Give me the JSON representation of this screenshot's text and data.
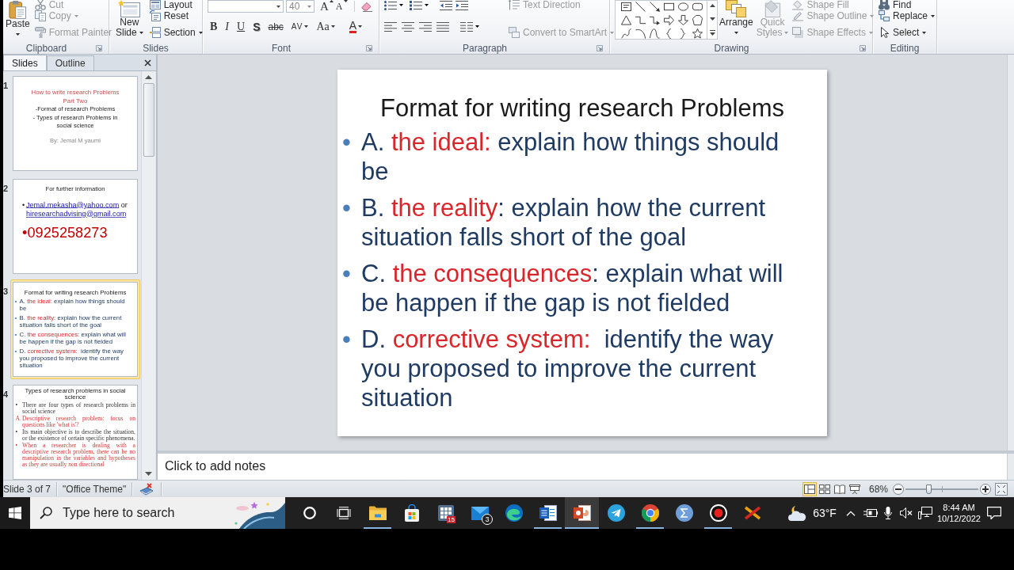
{
  "ribbon": {
    "clipboard": {
      "label": "Clipboard",
      "launcher": true,
      "paste": {
        "lines": [
          "Paste"
        ],
        "dropdown": true
      },
      "commands": [
        {
          "label": "Cut",
          "disabled": true,
          "dropdown": false
        },
        {
          "label": "Copy",
          "disabled": true,
          "dropdown": true
        },
        {
          "label": "Format Painter",
          "disabled": true,
          "dropdown": false
        }
      ]
    },
    "slides": {
      "label": "Slides",
      "new_slide": {
        "lines": [
          "New",
          "Slide"
        ],
        "dropdown": true
      },
      "commands": [
        {
          "label": "Layout",
          "disabled": false,
          "dropdown": false
        },
        {
          "label": "Reset",
          "disabled": false,
          "dropdown": false
        },
        {
          "label": "Section",
          "disabled": false,
          "dropdown": true
        }
      ]
    },
    "font": {
      "label": "Font",
      "launcher": true,
      "font_size": "40",
      "size_buttons": [
        {
          "kind": "grow",
          "glyph": "A"
        },
        {
          "kind": "shrink",
          "glyph": "A"
        }
      ],
      "format_buttons": [
        {
          "kind": "bold",
          "glyph": "B",
          "dropdown": false
        },
        {
          "kind": "italic",
          "glyph": "I",
          "dropdown": false
        },
        {
          "kind": "underline",
          "glyph": "U",
          "dropdown": false
        },
        {
          "kind": "shadow",
          "glyph": "S",
          "dropdown": false
        },
        {
          "kind": "strikethrough",
          "glyph": "abc",
          "dropdown": false
        },
        {
          "kind": "spacing",
          "glyph": "AV",
          "dropdown": true
        },
        {
          "kind": "case",
          "glyph": "Aa",
          "dropdown": true
        },
        {
          "kind": "color",
          "glyph": "A",
          "dropdown": true
        }
      ]
    },
    "paragraph": {
      "label": "Paragraph",
      "launcher": true,
      "commands": [
        {
          "label": "Text Direction",
          "disabled": true,
          "dropdown": false
        },
        {
          "label": "Convert to SmartArt",
          "disabled": true,
          "dropdown": true
        }
      ]
    },
    "drawing": {
      "label": "Drawing",
      "launcher": true,
      "arrange": {
        "lines": [
          "Arrange"
        ],
        "dropdown": true,
        "disabled": false
      },
      "quick_styles": {
        "lines": [
          "Quick",
          "Styles"
        ],
        "dropdown": true,
        "disabled": true
      },
      "commands": [
        {
          "label": "Shape Fill",
          "disabled": true,
          "dropdown": false
        },
        {
          "label": "Shape Outline",
          "disabled": true,
          "dropdown": true
        },
        {
          "label": "Shape Effects",
          "disabled": true,
          "dropdown": true
        }
      ]
    },
    "editing": {
      "label": "Editing",
      "commands": [
        {
          "label": "Find",
          "disabled": false,
          "dropdown": false
        },
        {
          "label": "Replace",
          "disabled": false,
          "dropdown": true
        },
        {
          "label": "Select",
          "disabled": false,
          "dropdown": true
        }
      ]
    }
  },
  "slides_pane": {
    "tabs": [
      {
        "label": "Slides",
        "selected": true
      },
      {
        "label": "Outline",
        "selected": false
      }
    ],
    "thumbnails": [
      {
        "number": "1",
        "selected": false,
        "kind": "title",
        "title_lines": [
          "How to write research Problems",
          "Part Two"
        ],
        "subtitle_lines": [
          "-Format of research Problems",
          "- Types of research Problems in social science"
        ],
        "byline": "By: Jemal M yaumi"
      },
      {
        "number": "2",
        "selected": false,
        "kind": "contact",
        "heading": "For further information",
        "contact": {
          "marker": "•",
          "links": [
            "Jemal.mekasha@yahoo.com",
            "hiresearchadvising@gmail.com"
          ],
          "joiner": "or"
        },
        "phone": {
          "marker": "•",
          "text": "0925258273"
        }
      },
      {
        "number": "3",
        "selected": true,
        "kind": "bullets",
        "title": "Format for writing research Problems",
        "bullets": [
          {
            "marker": "•",
            "letter": "A.",
            "term": "the ideal:",
            "rest": " explain how things should be"
          },
          {
            "marker": "•",
            "letter": "B.",
            "term": "the reality",
            "rest": ": explain how the current situation falls short of the goal"
          },
          {
            "marker": "•",
            "letter": "C.",
            "term": "the consequences",
            "rest": ": explain what will be happen if the gap is not fielded"
          },
          {
            "marker": "•",
            "letter": "D.",
            "term": "corrective system:",
            "rest": "  identify the way you proposed to improve the current situation"
          }
        ]
      },
      {
        "number": "4",
        "selected": false,
        "kind": "text",
        "title": "Types of research problems in social science",
        "paragraphs": [
          {
            "marker": "•",
            "text": "There are four types of research problems in social science",
            "emphasis": false
          },
          {
            "marker": "A.",
            "text": "Descriptive research problem: focus on questions like 'what is'?",
            "emphasis": true
          },
          {
            "marker": "•",
            "text": "Its main objective is to describe the situation, or the existence of certain specific phenomena.",
            "emphasis": false
          },
          {
            "marker": "•",
            "text": "When a researcher is dealing with a descriptive research problem, there can be no manipulation in the variables and hypotheses as they are usually non directional",
            "emphasis": true
          }
        ]
      }
    ]
  },
  "slide": {
    "title": "Format for writing research Problems",
    "bullets": [
      {
        "marker": "•",
        "letter": "A.",
        "term": "the ideal:",
        "rest": " explain how things should be"
      },
      {
        "marker": "•",
        "letter": "B.",
        "term": "the reality",
        "rest": ": explain how the current situation falls short of the goal"
      },
      {
        "marker": "•",
        "letter": "C.",
        "term": "the consequences",
        "rest": ": explain what will be happen if the gap is not fielded"
      },
      {
        "marker": "•",
        "letter": "D.",
        "term": "corrective system:",
        "rest": "  identify the way you proposed to improve the current situation"
      }
    ]
  },
  "notes": {
    "placeholder": "Click to add notes"
  },
  "status_bar": {
    "slide_indicator": "Slide 3 of 7",
    "theme": "\"Office Theme\"",
    "views": [
      {
        "kind": "normal",
        "selected": true
      },
      {
        "kind": "sorter",
        "selected": false
      },
      {
        "kind": "reading",
        "selected": false
      },
      {
        "kind": "slideshow",
        "selected": false
      }
    ],
    "zoom": "68%",
    "zoom_slider": {
      "level": 0.32
    }
  },
  "taskbar": {
    "search": {
      "placeholder": "Type here to search"
    },
    "apps": [
      {
        "kind": "cortana",
        "running": false,
        "selected": false
      },
      {
        "kind": "task_view",
        "running": false,
        "selected": false
      },
      {
        "kind": "explorer",
        "running": true,
        "selected": false
      },
      {
        "kind": "store",
        "running": false,
        "selected": false
      },
      {
        "kind": "grid",
        "running": false,
        "selected": false,
        "badge": "15"
      },
      {
        "kind": "mail",
        "running": false,
        "selected": false,
        "badge": "3"
      },
      {
        "kind": "edge",
        "running": false,
        "selected": false
      },
      {
        "kind": "word",
        "running": true,
        "selected": false
      },
      {
        "kind": "powerpoint",
        "running": true,
        "selected": true
      },
      {
        "kind": "telegram",
        "running": false,
        "selected": false
      },
      {
        "kind": "chrome",
        "running": true,
        "selected": false
      },
      {
        "kind": "sigma",
        "running": false,
        "selected": false
      },
      {
        "kind": "bandicam",
        "running": true,
        "selected": false
      },
      {
        "kind": "x_app",
        "running": false,
        "selected": false
      }
    ],
    "weather": "63°F",
    "time": "8:44 AM",
    "date": "10/12/2022"
  }
}
